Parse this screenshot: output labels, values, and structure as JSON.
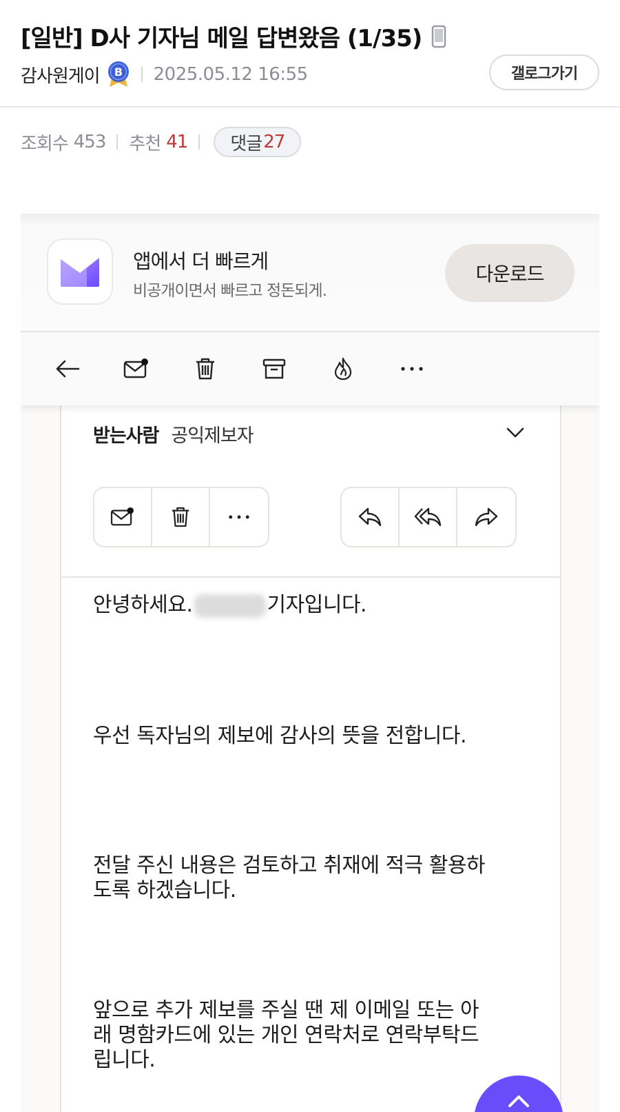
{
  "post": {
    "title": "[일반] D사 기자님 메일 답변왔음 (1/35)",
    "author": "감사원게이",
    "author_badge": "B",
    "date": "2025.05.12 16:55",
    "gallery_button": "갤로그가기",
    "views_label": "조회수",
    "views": "453",
    "recommend_label": "추천",
    "recommend": "41",
    "comments_label": "댓글",
    "comments": "27"
  },
  "mail_app": {
    "banner_title": "앱에서 더 빠르게",
    "banner_subtitle": "비공개이면서 빠르고 정돈되게.",
    "download_button": "다운로드",
    "recipient_label": "받는사람",
    "recipient_value": "공익제보자",
    "body": {
      "greeting_prefix": "안녕하세요.",
      "greeting_suffix": "기자입니다.",
      "line2": "우선 독자님의 제보에 감사의 뜻을 전합니다.",
      "line3a": "전달 주신 내용은 검토하고 취재에 적극 활용하",
      "line3b": "도록 하겠습니다.",
      "line4a": "앞으로 추가 제보를 주실 땐 제 이메일 또는 아",
      "line4b": "래 명함카드에 있는 개인 연락처로 연락부탁드",
      "line4c": "립니다."
    }
  },
  "colors": {
    "accent_red": "#c0393a",
    "brand_purple": "#6a4dfa",
    "muted_text": "#8a8d95"
  },
  "icons": [
    "mobile-icon",
    "badge-icon",
    "proton-mail-logo",
    "back-arrow-icon",
    "mark-unread-icon",
    "trash-icon",
    "archive-icon",
    "flame-icon",
    "more-icon",
    "chevron-down-icon",
    "reply-icon",
    "reply-all-icon",
    "forward-icon",
    "scroll-top-icon"
  ]
}
